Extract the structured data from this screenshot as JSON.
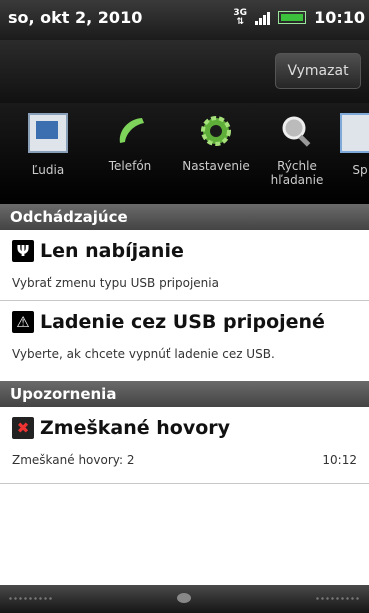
{
  "status_bar": {
    "date": "so, okt 2, 2010",
    "network": "3G",
    "time": "10:10"
  },
  "header": {
    "clear_button": "Vymazat"
  },
  "apps": [
    {
      "label": "Ľudia",
      "icon": "people-icon"
    },
    {
      "label": "Telefón",
      "icon": "phone-icon"
    },
    {
      "label": "Nastavenie",
      "icon": "settings-gear-icon"
    },
    {
      "label": "Rýchle hľadanie",
      "icon": "quick-search-icon"
    },
    {
      "label": "Sp",
      "icon": "messages-icon"
    }
  ],
  "sections": {
    "ongoing": "Odchádzajúce",
    "notifications": "Upozornenia"
  },
  "notifications": [
    {
      "title": "Len nabíjanie",
      "subtitle": "Vybrať zmenu typu USB pripojenia",
      "icon": "usb-icon"
    },
    {
      "title": "Ladenie cez USB pripojené",
      "subtitle": "Vyberte, ak chcete vypnúť ladenie cez USB.",
      "icon": "warning-icon"
    },
    {
      "title": "Zmeškané hovory",
      "subtitle": "Zmeškané hovory: 2",
      "time": "10:12",
      "icon": "missed-call-icon"
    }
  ]
}
